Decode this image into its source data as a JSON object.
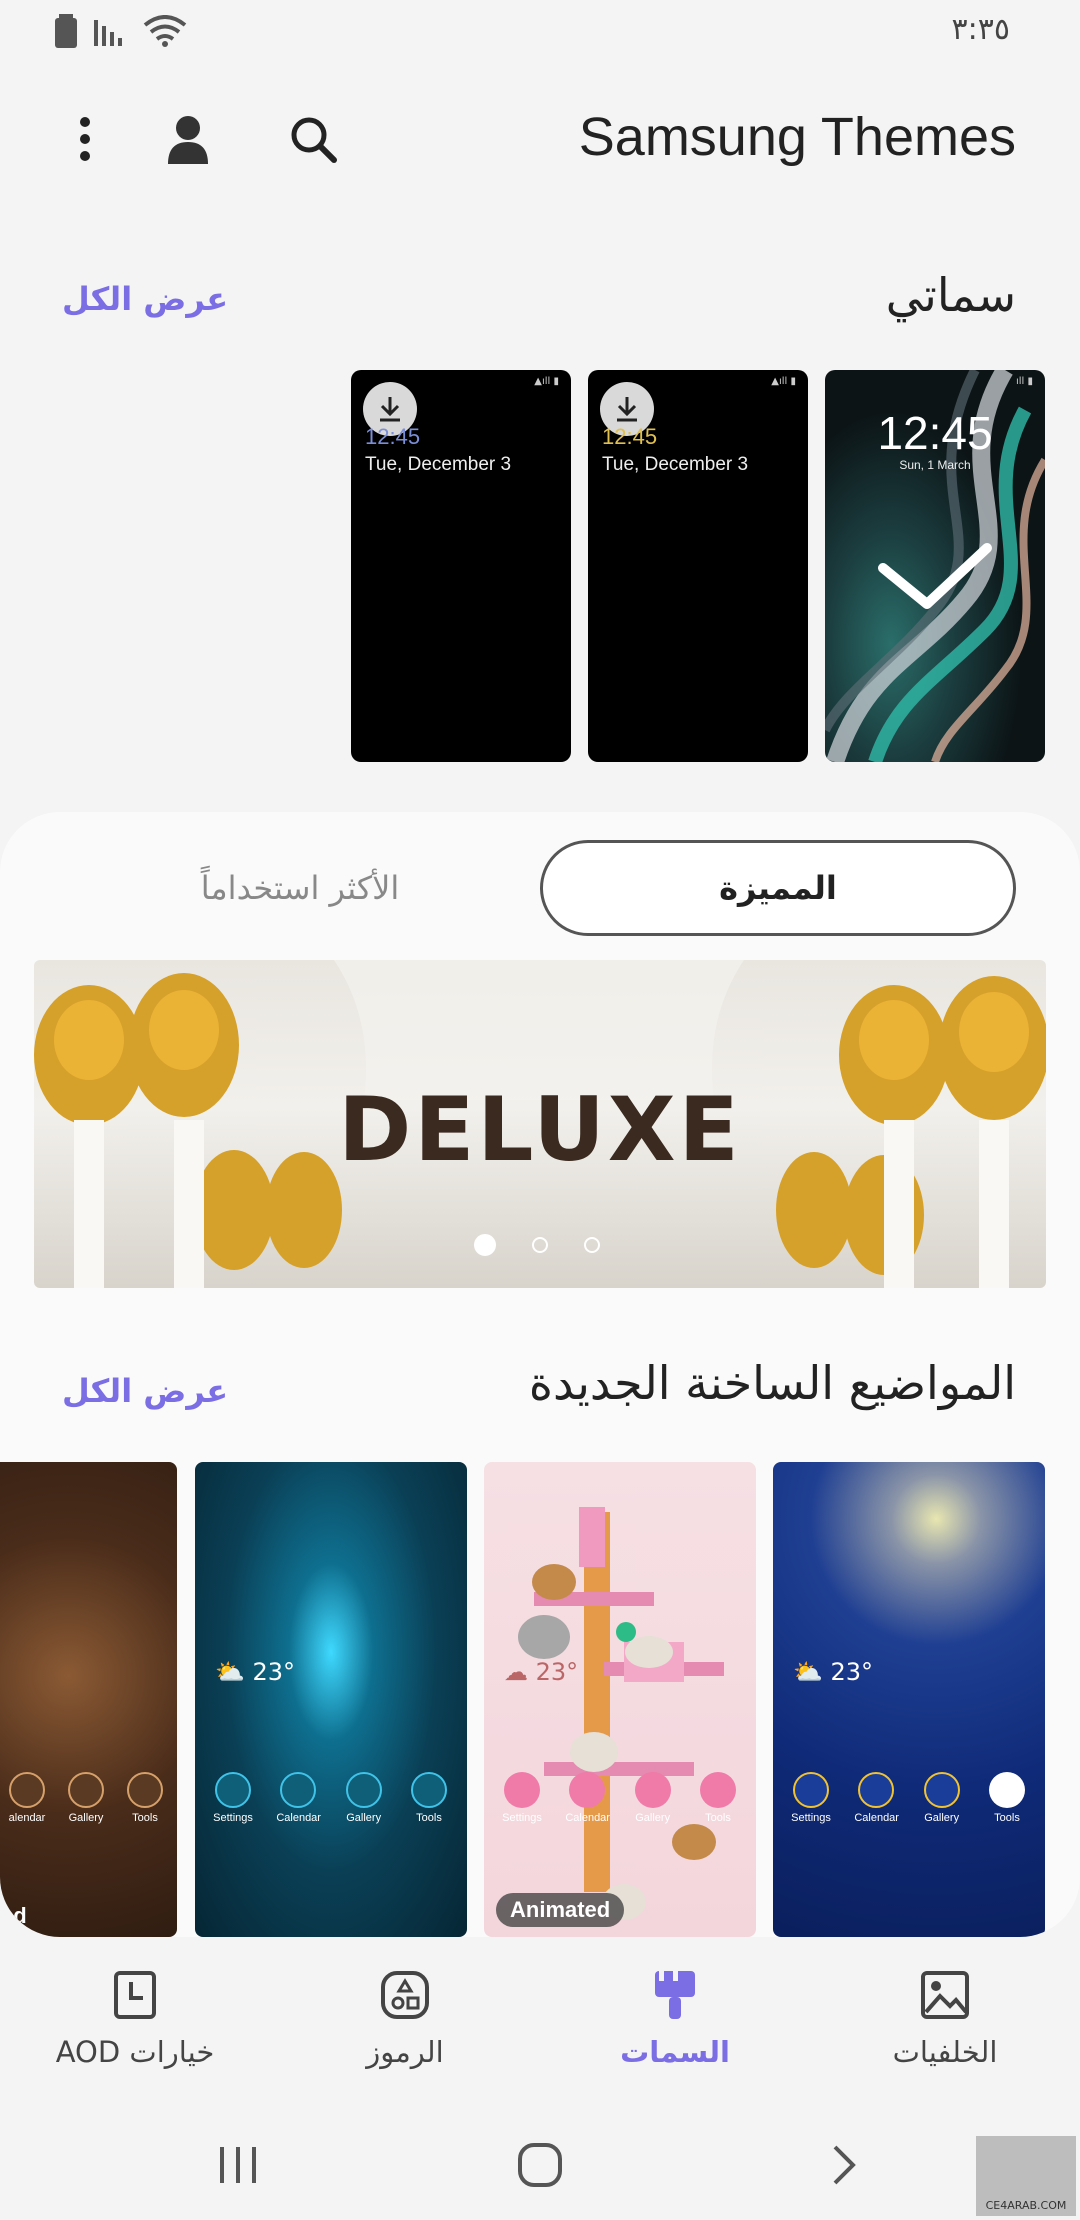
{
  "status": {
    "time": "٣:٣٥"
  },
  "header": {
    "title": "Samsung Themes"
  },
  "my_themes": {
    "title": "سماتي",
    "view_all": "عرض الكل",
    "cards": [
      {
        "time": "12:45",
        "date": "Tue, December 3",
        "time_color": "#7b8fd9"
      },
      {
        "time": "12:45",
        "date": "Tue, December 3",
        "time_color": "#e0c050"
      },
      {
        "time": "12:45",
        "date": "Sun, 1 March"
      }
    ]
  },
  "tabs": {
    "featured": "المميزة",
    "most_used": "الأكثر استخداماً"
  },
  "banner": {
    "word": "DELUXE"
  },
  "hot_themes": {
    "title": "المواضيع الساخنة الجديدة",
    "view_all": "عرض الكل",
    "cards": [
      {
        "temp": "23°",
        "apps": [
          "Settings",
          "Calendar",
          "Gallery",
          "Tools"
        ]
      },
      {
        "temp": "23°",
        "apps": [
          "Settings",
          "Calendar",
          "Gallery",
          "Tools"
        ],
        "tag": "Animated"
      },
      {
        "temp": "23°",
        "apps": [
          "Settings",
          "Calendar",
          "Gallery",
          "Tools"
        ]
      },
      {
        "apps": [
          "alendar",
          "Gallery",
          "Tools"
        ],
        "edge_text": "ad"
      }
    ]
  },
  "bottom_nav": {
    "wallpapers": "الخلفيات",
    "themes": "السمات",
    "icons": "الرموز",
    "aod": "خيارات AOD"
  },
  "watermark": {
    "text": "CE4ARAB.COM"
  },
  "colors": {
    "accent": "#7b6ee4",
    "background": "#f4f4f4"
  }
}
